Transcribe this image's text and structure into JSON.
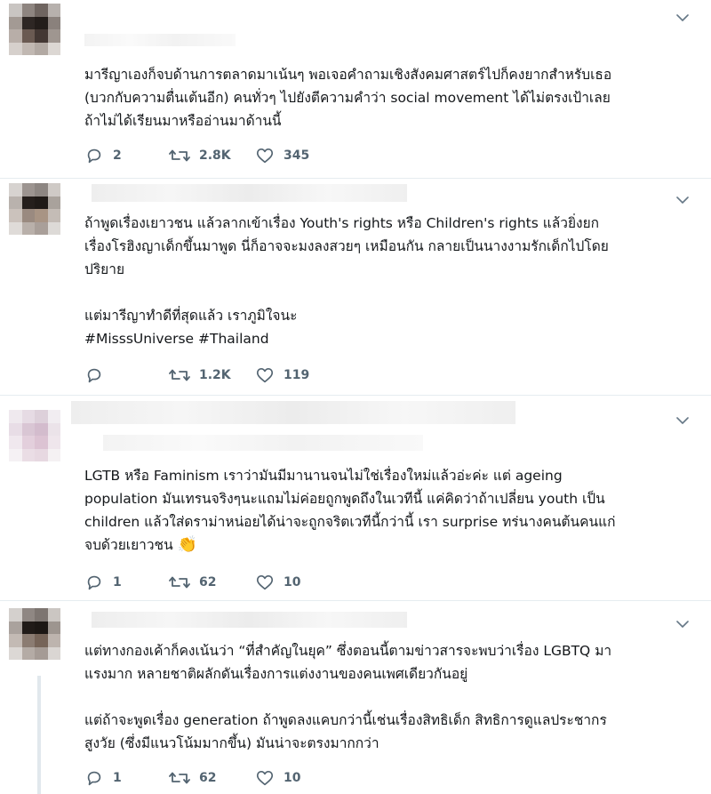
{
  "colors": {
    "text": "#14171a",
    "icon": "#536471",
    "divider": "#e6ecf0"
  },
  "icons": {
    "reply": "reply-bubble-icon",
    "retweet": "retweet-arrows-icon",
    "like": "heart-icon",
    "menu": "chevron-down-icon"
  },
  "tweets": [
    {
      "text": "มารีญาเองก็จบด้านการตลาดมาเน้นๆ พอเจอคำถามเชิงสังคมศาสตร์ไปก็คงยากสำหรับเธอ\n(บวกกับความตื่นเต้นอีก) คนทั่วๆ ไปยังตีความคำว่า social movement ได้ไม่ตรงเป้าเลย\nถ้าไม่ได้เรียนมาหรืออ่านมาด้านนี้",
      "replies": "2",
      "retweets": "2.8K",
      "likes": "345"
    },
    {
      "text": "ถ้าพูดเรื่องเยาวชน แล้วลากเข้าเรื่อง Youth's rights หรือ Children's rights แล้วยิ่งยก\nเรื่องโรฮิงญาเด็กขึ้นมาพูด นี่ก็อาจจะมงลงสวยๆ เหมือนกัน กลายเป็นนางงามรักเด็กไปโดย\nปริยาย\n\nแต่มารีญาทำดีที่สุดแล้ว เราภูมิใจนะ\n#MisssUniverse #Thailand",
      "replies": "",
      "retweets": "1.2K",
      "likes": "119"
    },
    {
      "text": "LGTB หรือ Faminism เราว่ามันมีมานานจนไม่ใช่เรื่องใหม่แล้วอ่ะค่ะ  แต่ ageing\npopulation มันเทรนจริงๆนะแถมไม่ค่อยถูกพูดถึงในเวทีนี้ แค่คิดว่าถ้าเปลี่ยน youth เป็น\nchildren แล้วใส่ดราม่าหน่อยได้น่าจะถูกจริตเวทีนี้กว่านี้ เรา surprise ทร่นางคนต้นคนแก่\nจบด้วยเยาวชน",
      "emoji": "👏",
      "replies": "1",
      "retweets": "62",
      "likes": "10"
    },
    {
      "text": "แต่ทางกองเค้าก็คงเน้นว่า “ที่สำคัญในยุค” ซึ่งตอนนี้ตามข่าวสารจะพบว่าเรื่อง LGBTQ มา\nแรงมาก หลายชาติผลักดันเรื่องการแต่งงานของคนเพศเดียวกันอยู่\n\nแต่ถ้าจะพูดเรื่อง generation ถ้าพูดลงแคบกว่านี้เช่นเรื่องสิทธิเด็ก สิทธิการดูแลประชากร\nสูงวัย (ซึ่งมีแนวโน้มมากขึ้น) มันน่าจะตรงมากกว่า",
      "replies": "1",
      "retweets": "62",
      "likes": "10"
    }
  ]
}
